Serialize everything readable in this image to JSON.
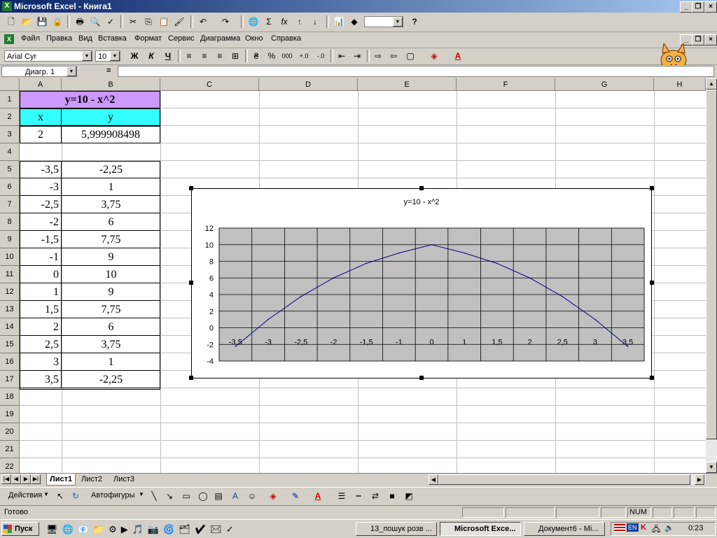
{
  "window": {
    "title": "Microsoft Excel - Книга1"
  },
  "menu": [
    "Файл",
    "Правка",
    "Вид",
    "Вставка",
    "Формат",
    "Сервис",
    "Диаграмма",
    "Окно",
    "Справка"
  ],
  "format": {
    "font": "Arial Cyr",
    "size": "10",
    "bold": "Ж",
    "italic": "К",
    "underline": "Ч",
    "percent": "%",
    "thousands": "000"
  },
  "formula_bar": {
    "name_box": "Диагр. 1",
    "equals": "="
  },
  "columns": [
    "A",
    "B",
    "C",
    "D",
    "E",
    "F",
    "G",
    "H"
  ],
  "rows": [
    "1",
    "2",
    "3",
    "4",
    "5",
    "6",
    "7",
    "8",
    "9",
    "10",
    "11",
    "12",
    "13",
    "14",
    "15",
    "16",
    "17",
    "18",
    "19",
    "20",
    "21",
    "22"
  ],
  "cells": {
    "title": "y=10 - x^2",
    "x_header": "x",
    "y_header": "y",
    "a3": "2",
    "b3": "5,999908498",
    "table_x": [
      "-3,5",
      "-3",
      "-2,5",
      "-2",
      "-1,5",
      "-1",
      "0",
      "1",
      "1,5",
      "2",
      "2,5",
      "3",
      "3,5"
    ],
    "table_y": [
      "-2,25",
      "1",
      "3,75",
      "6",
      "7,75",
      "9",
      "10",
      "9",
      "7,75",
      "6",
      "3,75",
      "1",
      "-2,25"
    ]
  },
  "colors": {
    "title_fill": "#cc99ff",
    "header_fill": "#33ffff",
    "plot_area": "#c0c0c0",
    "series_line": "#000080"
  },
  "chart_data": {
    "type": "line",
    "title": "y=10 - x^2",
    "categories": [
      "-3,5",
      "-3",
      "-2,5",
      "-2",
      "-1,5",
      "-1",
      "0",
      "1",
      "1,5",
      "2",
      "2,5",
      "3",
      "3,5"
    ],
    "series": [
      {
        "values": [
          -2.25,
          1,
          3.75,
          6,
          7.75,
          9,
          10,
          9,
          7.75,
          6,
          3.75,
          1,
          -2.25
        ]
      }
    ],
    "y_ticks": [
      "12",
      "10",
      "8",
      "6",
      "4",
      "2",
      "0",
      "-2",
      "-4"
    ],
    "ylim": [
      -4,
      12
    ],
    "grid": true,
    "legend": "none"
  },
  "sheets": [
    "Лист1",
    "Лист2",
    "Лист3"
  ],
  "drawing": {
    "actions": "Действия",
    "autoshapes": "Автофигуры"
  },
  "status": {
    "ready": "Готово",
    "num": "NUM"
  },
  "taskbar": {
    "start": "Пуск",
    "tasks": [
      "13_пошук розв ...",
      "Microsoft Exce...",
      "Документ6 - Mi..."
    ],
    "lang": "EN",
    "clock": "0:23"
  }
}
